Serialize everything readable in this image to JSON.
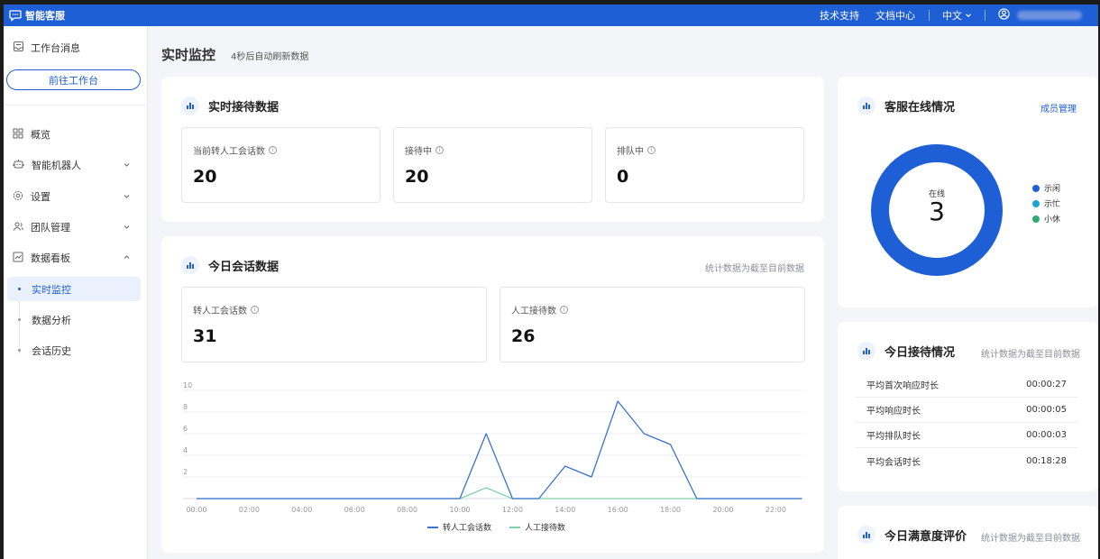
{
  "header": {
    "brand": "智能客服",
    "links": [
      "技术支持",
      "文档中心"
    ],
    "language": "中文"
  },
  "sidebar": {
    "workbench_msg": "工作台消息",
    "go_button": "前往工作台",
    "nav": [
      {
        "label": "概览"
      },
      {
        "label": "智能机器人"
      },
      {
        "label": "设置"
      },
      {
        "label": "团队管理"
      },
      {
        "label": "数据看板"
      }
    ],
    "sub": [
      {
        "label": "实时监控"
      },
      {
        "label": "数据分析"
      },
      {
        "label": "会话历史"
      }
    ]
  },
  "page": {
    "title": "实时监控",
    "subtitle": "4秒后自动刷新数据"
  },
  "realtime": {
    "title": "实时接待数据",
    "stats": [
      {
        "label": "当前转人工会话数",
        "value": "20"
      },
      {
        "label": "接待中",
        "value": "20"
      },
      {
        "label": "排队中",
        "value": "0"
      }
    ]
  },
  "today": {
    "title": "今日会话数据",
    "note": "统计数据为截至目前数据",
    "stats": [
      {
        "label": "转人工会话数",
        "value": "31"
      },
      {
        "label": "人工接待数",
        "value": "26"
      }
    ]
  },
  "online": {
    "title": "客服在线情况",
    "link": "成员管理",
    "center_label": "在线",
    "center_value": "3",
    "legend": [
      {
        "label": "示闲",
        "color": "#1f5fd6"
      },
      {
        "label": "示忙",
        "color": "#1aa3d4"
      },
      {
        "label": "小休",
        "color": "#2eaa6e"
      }
    ],
    "ring_color": "#1f5fd6"
  },
  "reception": {
    "title": "今日接待情况",
    "note": "统计数据为截至目前数据",
    "rows": [
      {
        "label": "平均首次响应时长",
        "value": "00:00:27"
      },
      {
        "label": "平均响应时长",
        "value": "00:00:05"
      },
      {
        "label": "平均排队时长",
        "value": "00:00:03"
      },
      {
        "label": "平均会话时长",
        "value": "00:18:28"
      }
    ]
  },
  "satisfaction": {
    "title": "今日满意度评价",
    "note": "统计数据为截至目前数据"
  },
  "chart_data": {
    "type": "line",
    "x": [
      "00:00",
      "01:00",
      "02:00",
      "03:00",
      "04:00",
      "05:00",
      "06:00",
      "07:00",
      "08:00",
      "09:00",
      "10:00",
      "11:00",
      "12:00",
      "13:00",
      "14:00",
      "15:00",
      "16:00",
      "17:00",
      "18:00",
      "19:00",
      "20:00",
      "21:00",
      "22:00",
      "23:00"
    ],
    "xticks": [
      "00:00",
      "02:00",
      "04:00",
      "06:00",
      "08:00",
      "10:00",
      "12:00",
      "14:00",
      "16:00",
      "18:00",
      "20:00",
      "22:00"
    ],
    "yticks": [
      "2",
      "4",
      "6",
      "8",
      "10"
    ],
    "ylim": [
      0,
      10
    ],
    "series": [
      {
        "name": "转人工会话数",
        "color": "#3a72d0",
        "values": [
          0,
          0,
          0,
          0,
          0,
          0,
          0,
          0,
          0,
          0,
          0,
          6,
          0,
          0,
          3,
          2,
          9,
          6,
          5,
          0,
          0,
          0,
          0,
          0
        ]
      },
      {
        "name": "人工接待数",
        "color": "#7fd1a8",
        "values": [
          0,
          0,
          0,
          0,
          0,
          0,
          0,
          0,
          0,
          0,
          0,
          1,
          0,
          0,
          0,
          0,
          0,
          0,
          0,
          0,
          0,
          0,
          0,
          0
        ]
      }
    ]
  }
}
